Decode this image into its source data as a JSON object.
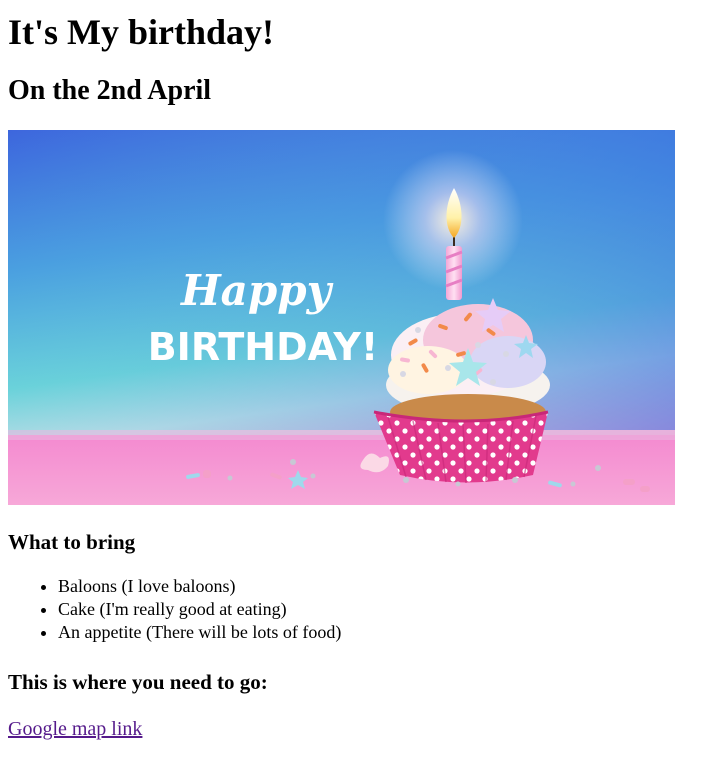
{
  "page": {
    "title": "It's My birthday!",
    "date_heading": "On the 2nd April",
    "banner": {
      "happy_text": "Happy",
      "birthday_text": "BIRTHDAY!"
    },
    "bring_heading": "What to bring",
    "bring_items": [
      "Baloons (I love baloons)",
      "Cake (I'm really good at eating)",
      "An appetite (There will be lots of food)"
    ],
    "go_heading": "This is where you need to go:",
    "map_link_label": "Google map link"
  },
  "colors": {
    "link_visited": "#551a8b",
    "sky_top": "#3f6fe0",
    "sky_mid": "#54c0dc",
    "table_pink": "#f06bc0",
    "cup_pink": "#e23a8d"
  },
  "icons": {
    "banner": "birthday-cupcake-image"
  }
}
